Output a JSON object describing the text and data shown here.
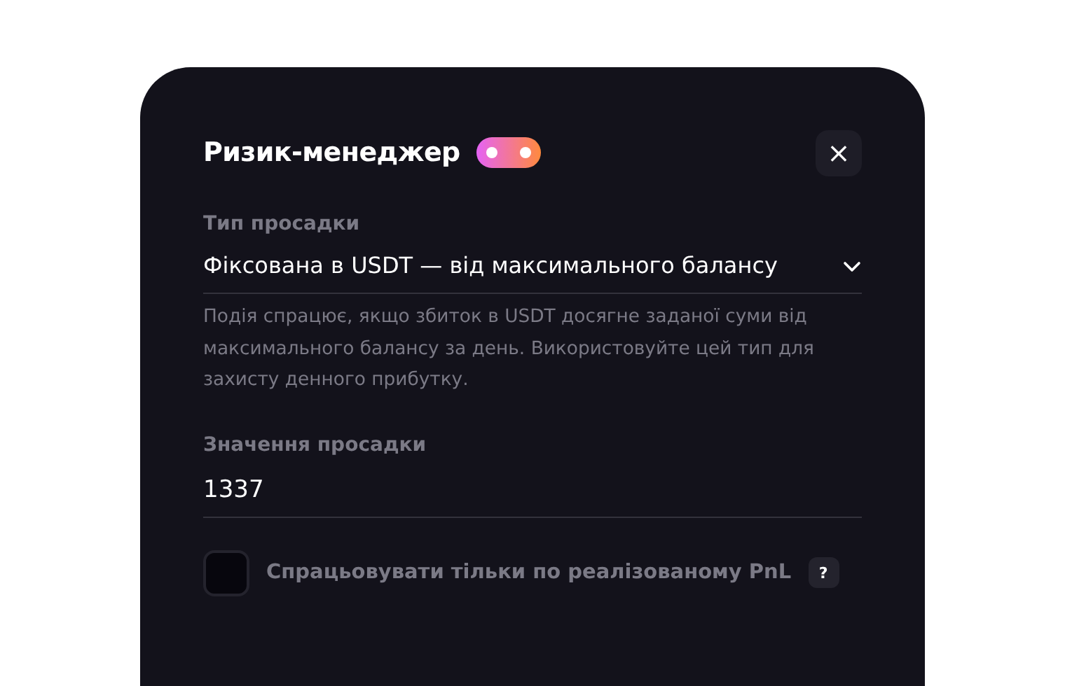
{
  "dialog": {
    "title": "Ризик-менеджер",
    "toggle": {
      "on": true
    },
    "close": "×"
  },
  "drawdown_type": {
    "label": "Тип просадки",
    "value": "Фіксована в USDT — від максимального балансу",
    "help": "Подія спрацює, якщо збиток в USDT досягне заданої суми від максимального балансу за день. Використовуйте цей тип для захисту денного прибутку."
  },
  "drawdown_value": {
    "label": "Значення просадки",
    "value": "1337"
  },
  "realized_only": {
    "label": "Спрацьовувати тільки по реалізованому PnL",
    "checked": false,
    "hint": "?"
  }
}
